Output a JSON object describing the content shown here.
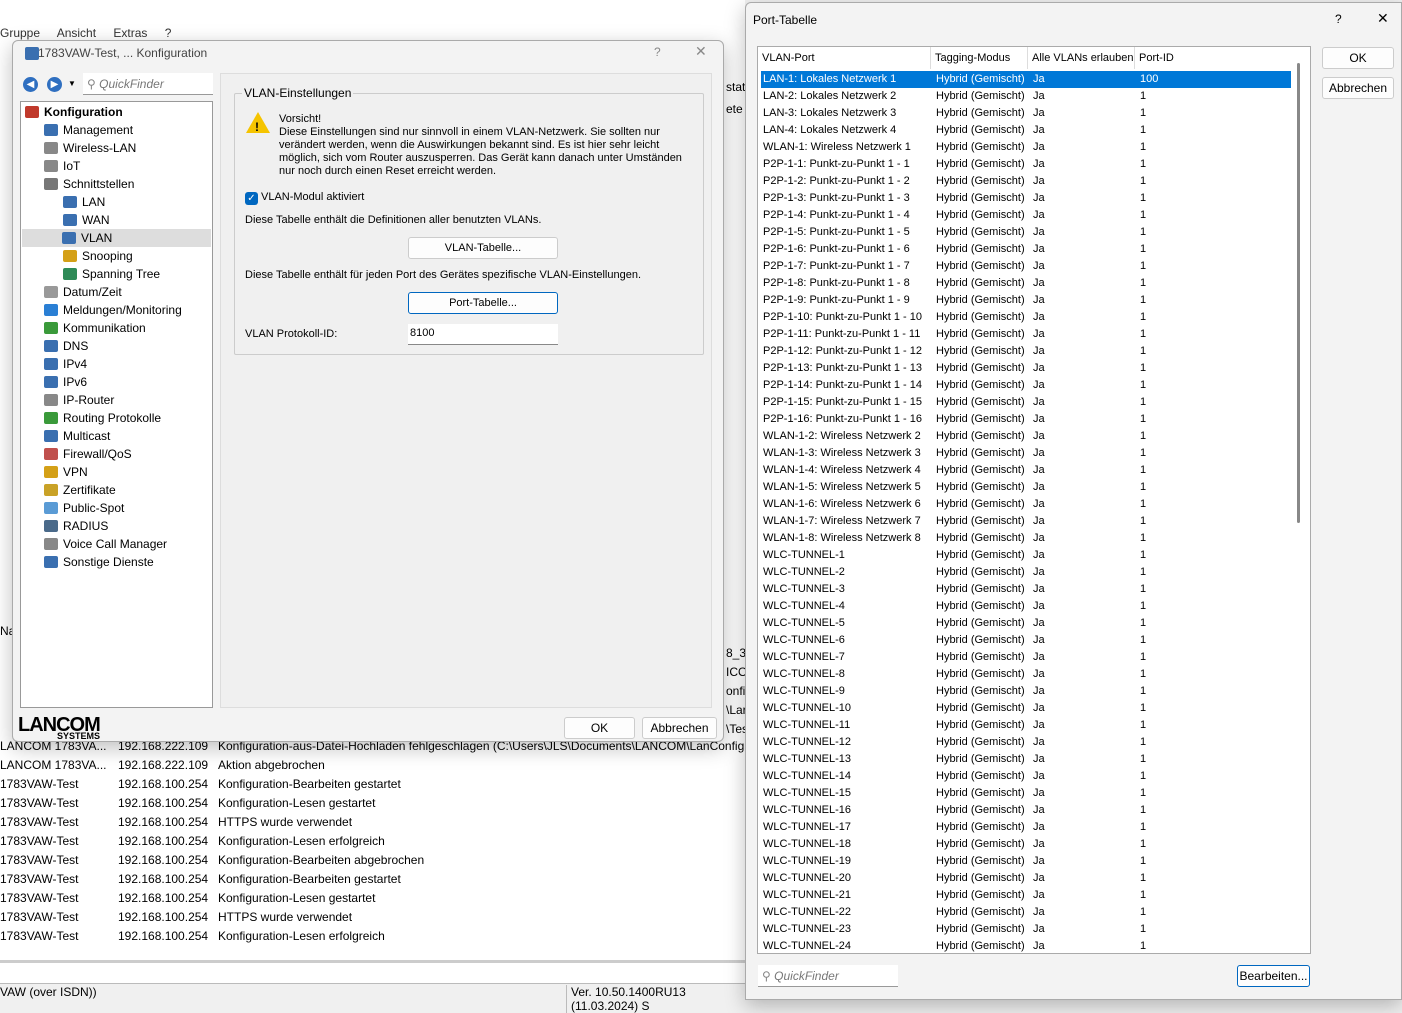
{
  "background": {
    "menu": [
      "Gruppe",
      "Ansicht",
      "Extras",
      "?"
    ],
    "side_fragments": [
      "stat",
      "ete",
      "Na",
      "8_3",
      "ICO",
      "onfi",
      "\\Lar",
      "\\Tes"
    ],
    "log": [
      [
        "LANCOM 1783VA...",
        "192.168.222.109",
        "Konfiguration-aus-Datei-Hochladen fehlgeschlagen (C:\\Users\\JLS\\Documents\\LANCOM\\LanConfig"
      ],
      [
        "LANCOM 1783VA...",
        "192.168.222.109",
        "Aktion abgebrochen"
      ],
      [
        "1783VAW-Test",
        "192.168.100.254",
        "Konfiguration-Bearbeiten gestartet"
      ],
      [
        "1783VAW-Test",
        "192.168.100.254",
        "Konfiguration-Lesen gestartet"
      ],
      [
        "1783VAW-Test",
        "192.168.100.254",
        "HTTPS wurde verwendet"
      ],
      [
        "1783VAW-Test",
        "192.168.100.254",
        "Konfiguration-Lesen erfolgreich"
      ],
      [
        "1783VAW-Test",
        "192.168.100.254",
        "Konfiguration-Bearbeiten abgebrochen"
      ],
      [
        "1783VAW-Test",
        "192.168.100.254",
        "Konfiguration-Bearbeiten gestartet"
      ],
      [
        "1783VAW-Test",
        "192.168.100.254",
        "Konfiguration-Lesen gestartet"
      ],
      [
        "1783VAW-Test",
        "192.168.100.254",
        "HTTPS wurde verwendet"
      ],
      [
        "1783VAW-Test",
        "192.168.100.254",
        "Konfiguration-Lesen erfolgreich"
      ]
    ],
    "status_left": "VAW (over ISDN))",
    "status_right": "Ver. 10.50.1400RU13 (11.03.2024) S"
  },
  "config": {
    "title": "1783VAW-Test, ... Konfiguration",
    "help": "?",
    "close": "✕",
    "quickfinder_placeholder": "QuickFinder",
    "tree": [
      {
        "label": "Konfiguration",
        "level": 0,
        "bold": true,
        "color": "#c0392b"
      },
      {
        "label": "Management",
        "level": 1,
        "color": "#3a6fb0"
      },
      {
        "label": "Wireless-LAN",
        "level": 1,
        "color": "#888"
      },
      {
        "label": "IoT",
        "level": 1,
        "color": "#888"
      },
      {
        "label": "Schnittstellen",
        "level": 1,
        "color": "#777"
      },
      {
        "label": "LAN",
        "level": 2,
        "color": "#3a6fb0"
      },
      {
        "label": "WAN",
        "level": 2,
        "color": "#3a6fb0"
      },
      {
        "label": "VLAN",
        "level": 2,
        "color": "#3a6fb0",
        "selected": true
      },
      {
        "label": "Snooping",
        "level": 2,
        "color": "#d4a017"
      },
      {
        "label": "Spanning Tree",
        "level": 2,
        "color": "#2e8b57"
      },
      {
        "label": "Datum/Zeit",
        "level": 1,
        "color": "#999"
      },
      {
        "label": "Meldungen/Monitoring",
        "level": 1,
        "color": "#2a7fd4"
      },
      {
        "label": "Kommunikation",
        "level": 1,
        "color": "#3a9a3a"
      },
      {
        "label": "DNS",
        "level": 1,
        "color": "#3a6fb0"
      },
      {
        "label": "IPv4",
        "level": 1,
        "color": "#3a6fb0"
      },
      {
        "label": "IPv6",
        "level": 1,
        "color": "#3a6fb0"
      },
      {
        "label": "IP-Router",
        "level": 1,
        "color": "#888"
      },
      {
        "label": "Routing Protokolle",
        "level": 1,
        "color": "#3a9a3a"
      },
      {
        "label": "Multicast",
        "level": 1,
        "color": "#3a6fb0"
      },
      {
        "label": "Firewall/QoS",
        "level": 1,
        "color": "#c0504d"
      },
      {
        "label": "VPN",
        "level": 1,
        "color": "#d4a017"
      },
      {
        "label": "Zertifikate",
        "level": 1,
        "color": "#c9a227"
      },
      {
        "label": "Public-Spot",
        "level": 1,
        "color": "#5a9bd5"
      },
      {
        "label": "RADIUS",
        "level": 1,
        "color": "#4a6a8a"
      },
      {
        "label": "Voice Call Manager",
        "level": 1,
        "color": "#888"
      },
      {
        "label": "Sonstige Dienste",
        "level": 1,
        "color": "#3a6fb0"
      }
    ],
    "group_title": "VLAN-Einstellungen",
    "warning_title": "Vorsicht!",
    "warning_text": "Diese Einstellungen sind nur sinnvoll in einem VLAN-Netzwerk. Sie sollten nur verändert werden, wenn die Auswirkungen bekannt sind. Es ist hier sehr leicht möglich, sich vom Router auszusperren. Das Gerät kann danach unter Umständen nur noch durch einen Reset erreicht werden.",
    "vlan_module_label": "VLAN-Modul aktiviert",
    "vlan_module_checked": true,
    "vlan_table_desc": "Diese Tabelle enthält die Definitionen aller benutzten VLANs.",
    "vlan_table_button": "VLAN-Tabelle...",
    "port_table_desc": "Diese Tabelle enthält für jeden Port des Gerätes spezifische VLAN-Einstellungen.",
    "port_table_button": "Port-Tabelle...",
    "protocol_id_label": "VLAN Protokoll-ID:",
    "protocol_id_value": "8100",
    "logo_main": "LANCOM",
    "logo_sub": "SYSTEMS",
    "ok": "OK",
    "cancel": "Abbrechen"
  },
  "port_table": {
    "title": "Port-Tabelle",
    "help": "?",
    "close": "✕",
    "columns": [
      "VLAN-Port",
      "Tagging-Modus",
      "Alle VLANs erlauben",
      "Port-ID"
    ],
    "rows": [
      [
        "LAN-1: Lokales Netzwerk 1",
        "Hybrid (Gemischt)",
        "Ja",
        "100"
      ],
      [
        "LAN-2: Lokales Netzwerk 2",
        "Hybrid (Gemischt)",
        "Ja",
        "1"
      ],
      [
        "LAN-3: Lokales Netzwerk 3",
        "Hybrid (Gemischt)",
        "Ja",
        "1"
      ],
      [
        "LAN-4: Lokales Netzwerk 4",
        "Hybrid (Gemischt)",
        "Ja",
        "1"
      ],
      [
        "WLAN-1: Wireless Netzwerk 1",
        "Hybrid (Gemischt)",
        "Ja",
        "1"
      ],
      [
        "P2P-1-1: Punkt-zu-Punkt 1 - 1",
        "Hybrid (Gemischt)",
        "Ja",
        "1"
      ],
      [
        "P2P-1-2: Punkt-zu-Punkt 1 - 2",
        "Hybrid (Gemischt)",
        "Ja",
        "1"
      ],
      [
        "P2P-1-3: Punkt-zu-Punkt 1 - 3",
        "Hybrid (Gemischt)",
        "Ja",
        "1"
      ],
      [
        "P2P-1-4: Punkt-zu-Punkt 1 - 4",
        "Hybrid (Gemischt)",
        "Ja",
        "1"
      ],
      [
        "P2P-1-5: Punkt-zu-Punkt 1 - 5",
        "Hybrid (Gemischt)",
        "Ja",
        "1"
      ],
      [
        "P2P-1-6: Punkt-zu-Punkt 1 - 6",
        "Hybrid (Gemischt)",
        "Ja",
        "1"
      ],
      [
        "P2P-1-7: Punkt-zu-Punkt 1 - 7",
        "Hybrid (Gemischt)",
        "Ja",
        "1"
      ],
      [
        "P2P-1-8: Punkt-zu-Punkt 1 - 8",
        "Hybrid (Gemischt)",
        "Ja",
        "1"
      ],
      [
        "P2P-1-9: Punkt-zu-Punkt 1 - 9",
        "Hybrid (Gemischt)",
        "Ja",
        "1"
      ],
      [
        "P2P-1-10: Punkt-zu-Punkt 1 - 10",
        "Hybrid (Gemischt)",
        "Ja",
        "1"
      ],
      [
        "P2P-1-11: Punkt-zu-Punkt 1 - 11",
        "Hybrid (Gemischt)",
        "Ja",
        "1"
      ],
      [
        "P2P-1-12: Punkt-zu-Punkt 1 - 12",
        "Hybrid (Gemischt)",
        "Ja",
        "1"
      ],
      [
        "P2P-1-13: Punkt-zu-Punkt 1 - 13",
        "Hybrid (Gemischt)",
        "Ja",
        "1"
      ],
      [
        "P2P-1-14: Punkt-zu-Punkt 1 - 14",
        "Hybrid (Gemischt)",
        "Ja",
        "1"
      ],
      [
        "P2P-1-15: Punkt-zu-Punkt 1 - 15",
        "Hybrid (Gemischt)",
        "Ja",
        "1"
      ],
      [
        "P2P-1-16: Punkt-zu-Punkt 1 - 16",
        "Hybrid (Gemischt)",
        "Ja",
        "1"
      ],
      [
        "WLAN-1-2: Wireless Netzwerk 2",
        "Hybrid (Gemischt)",
        "Ja",
        "1"
      ],
      [
        "WLAN-1-3: Wireless Netzwerk 3",
        "Hybrid (Gemischt)",
        "Ja",
        "1"
      ],
      [
        "WLAN-1-4: Wireless Netzwerk 4",
        "Hybrid (Gemischt)",
        "Ja",
        "1"
      ],
      [
        "WLAN-1-5: Wireless Netzwerk 5",
        "Hybrid (Gemischt)",
        "Ja",
        "1"
      ],
      [
        "WLAN-1-6: Wireless Netzwerk 6",
        "Hybrid (Gemischt)",
        "Ja",
        "1"
      ],
      [
        "WLAN-1-7: Wireless Netzwerk 7",
        "Hybrid (Gemischt)",
        "Ja",
        "1"
      ],
      [
        "WLAN-1-8: Wireless Netzwerk 8",
        "Hybrid (Gemischt)",
        "Ja",
        "1"
      ],
      [
        "WLC-TUNNEL-1",
        "Hybrid (Gemischt)",
        "Ja",
        "1"
      ],
      [
        "WLC-TUNNEL-2",
        "Hybrid (Gemischt)",
        "Ja",
        "1"
      ],
      [
        "WLC-TUNNEL-3",
        "Hybrid (Gemischt)",
        "Ja",
        "1"
      ],
      [
        "WLC-TUNNEL-4",
        "Hybrid (Gemischt)",
        "Ja",
        "1"
      ],
      [
        "WLC-TUNNEL-5",
        "Hybrid (Gemischt)",
        "Ja",
        "1"
      ],
      [
        "WLC-TUNNEL-6",
        "Hybrid (Gemischt)",
        "Ja",
        "1"
      ],
      [
        "WLC-TUNNEL-7",
        "Hybrid (Gemischt)",
        "Ja",
        "1"
      ],
      [
        "WLC-TUNNEL-8",
        "Hybrid (Gemischt)",
        "Ja",
        "1"
      ],
      [
        "WLC-TUNNEL-9",
        "Hybrid (Gemischt)",
        "Ja",
        "1"
      ],
      [
        "WLC-TUNNEL-10",
        "Hybrid (Gemischt)",
        "Ja",
        "1"
      ],
      [
        "WLC-TUNNEL-11",
        "Hybrid (Gemischt)",
        "Ja",
        "1"
      ],
      [
        "WLC-TUNNEL-12",
        "Hybrid (Gemischt)",
        "Ja",
        "1"
      ],
      [
        "WLC-TUNNEL-13",
        "Hybrid (Gemischt)",
        "Ja",
        "1"
      ],
      [
        "WLC-TUNNEL-14",
        "Hybrid (Gemischt)",
        "Ja",
        "1"
      ],
      [
        "WLC-TUNNEL-15",
        "Hybrid (Gemischt)",
        "Ja",
        "1"
      ],
      [
        "WLC-TUNNEL-16",
        "Hybrid (Gemischt)",
        "Ja",
        "1"
      ],
      [
        "WLC-TUNNEL-17",
        "Hybrid (Gemischt)",
        "Ja",
        "1"
      ],
      [
        "WLC-TUNNEL-18",
        "Hybrid (Gemischt)",
        "Ja",
        "1"
      ],
      [
        "WLC-TUNNEL-19",
        "Hybrid (Gemischt)",
        "Ja",
        "1"
      ],
      [
        "WLC-TUNNEL-20",
        "Hybrid (Gemischt)",
        "Ja",
        "1"
      ],
      [
        "WLC-TUNNEL-21",
        "Hybrid (Gemischt)",
        "Ja",
        "1"
      ],
      [
        "WLC-TUNNEL-22",
        "Hybrid (Gemischt)",
        "Ja",
        "1"
      ],
      [
        "WLC-TUNNEL-23",
        "Hybrid (Gemischt)",
        "Ja",
        "1"
      ],
      [
        "WLC-TUNNEL-24",
        "Hybrid (Gemischt)",
        "Ja",
        "1"
      ]
    ],
    "selected_row": 0,
    "ok": "OK",
    "cancel": "Abbrechen",
    "quickfinder_placeholder": "QuickFinder",
    "edit_button": "Bearbeiten...",
    "selection_color": "#0078d7"
  }
}
